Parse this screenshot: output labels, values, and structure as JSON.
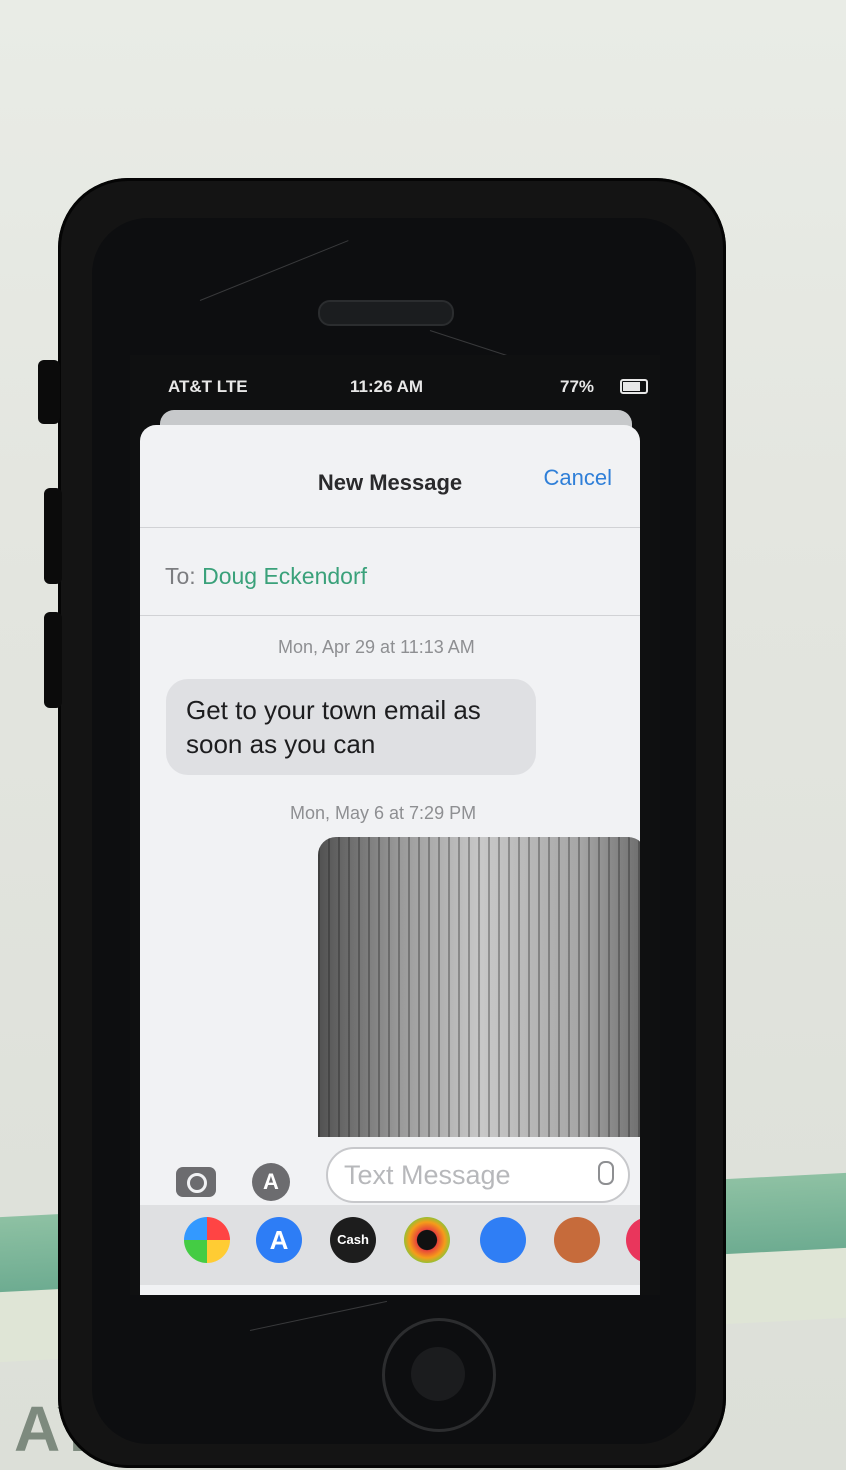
{
  "status_bar": {
    "carrier": "AT&T LTE",
    "time": "11:26 AM",
    "battery": "77%"
  },
  "compose": {
    "title": "New Message",
    "cancel_label": "Cancel",
    "to_label": "To:",
    "recipient": "Doug Eckendorf"
  },
  "thread": {
    "ts1": "Mon, Apr 29 at 11:13 AM",
    "message1": "Get to your town email as soon as you can",
    "ts2": "Mon, May 6 at 7:29 PM"
  },
  "input": {
    "placeholder": "Text Message"
  },
  "app_drawer": {
    "cash_label": "Cash"
  },
  "background": {
    "partial_word": "AY"
  }
}
